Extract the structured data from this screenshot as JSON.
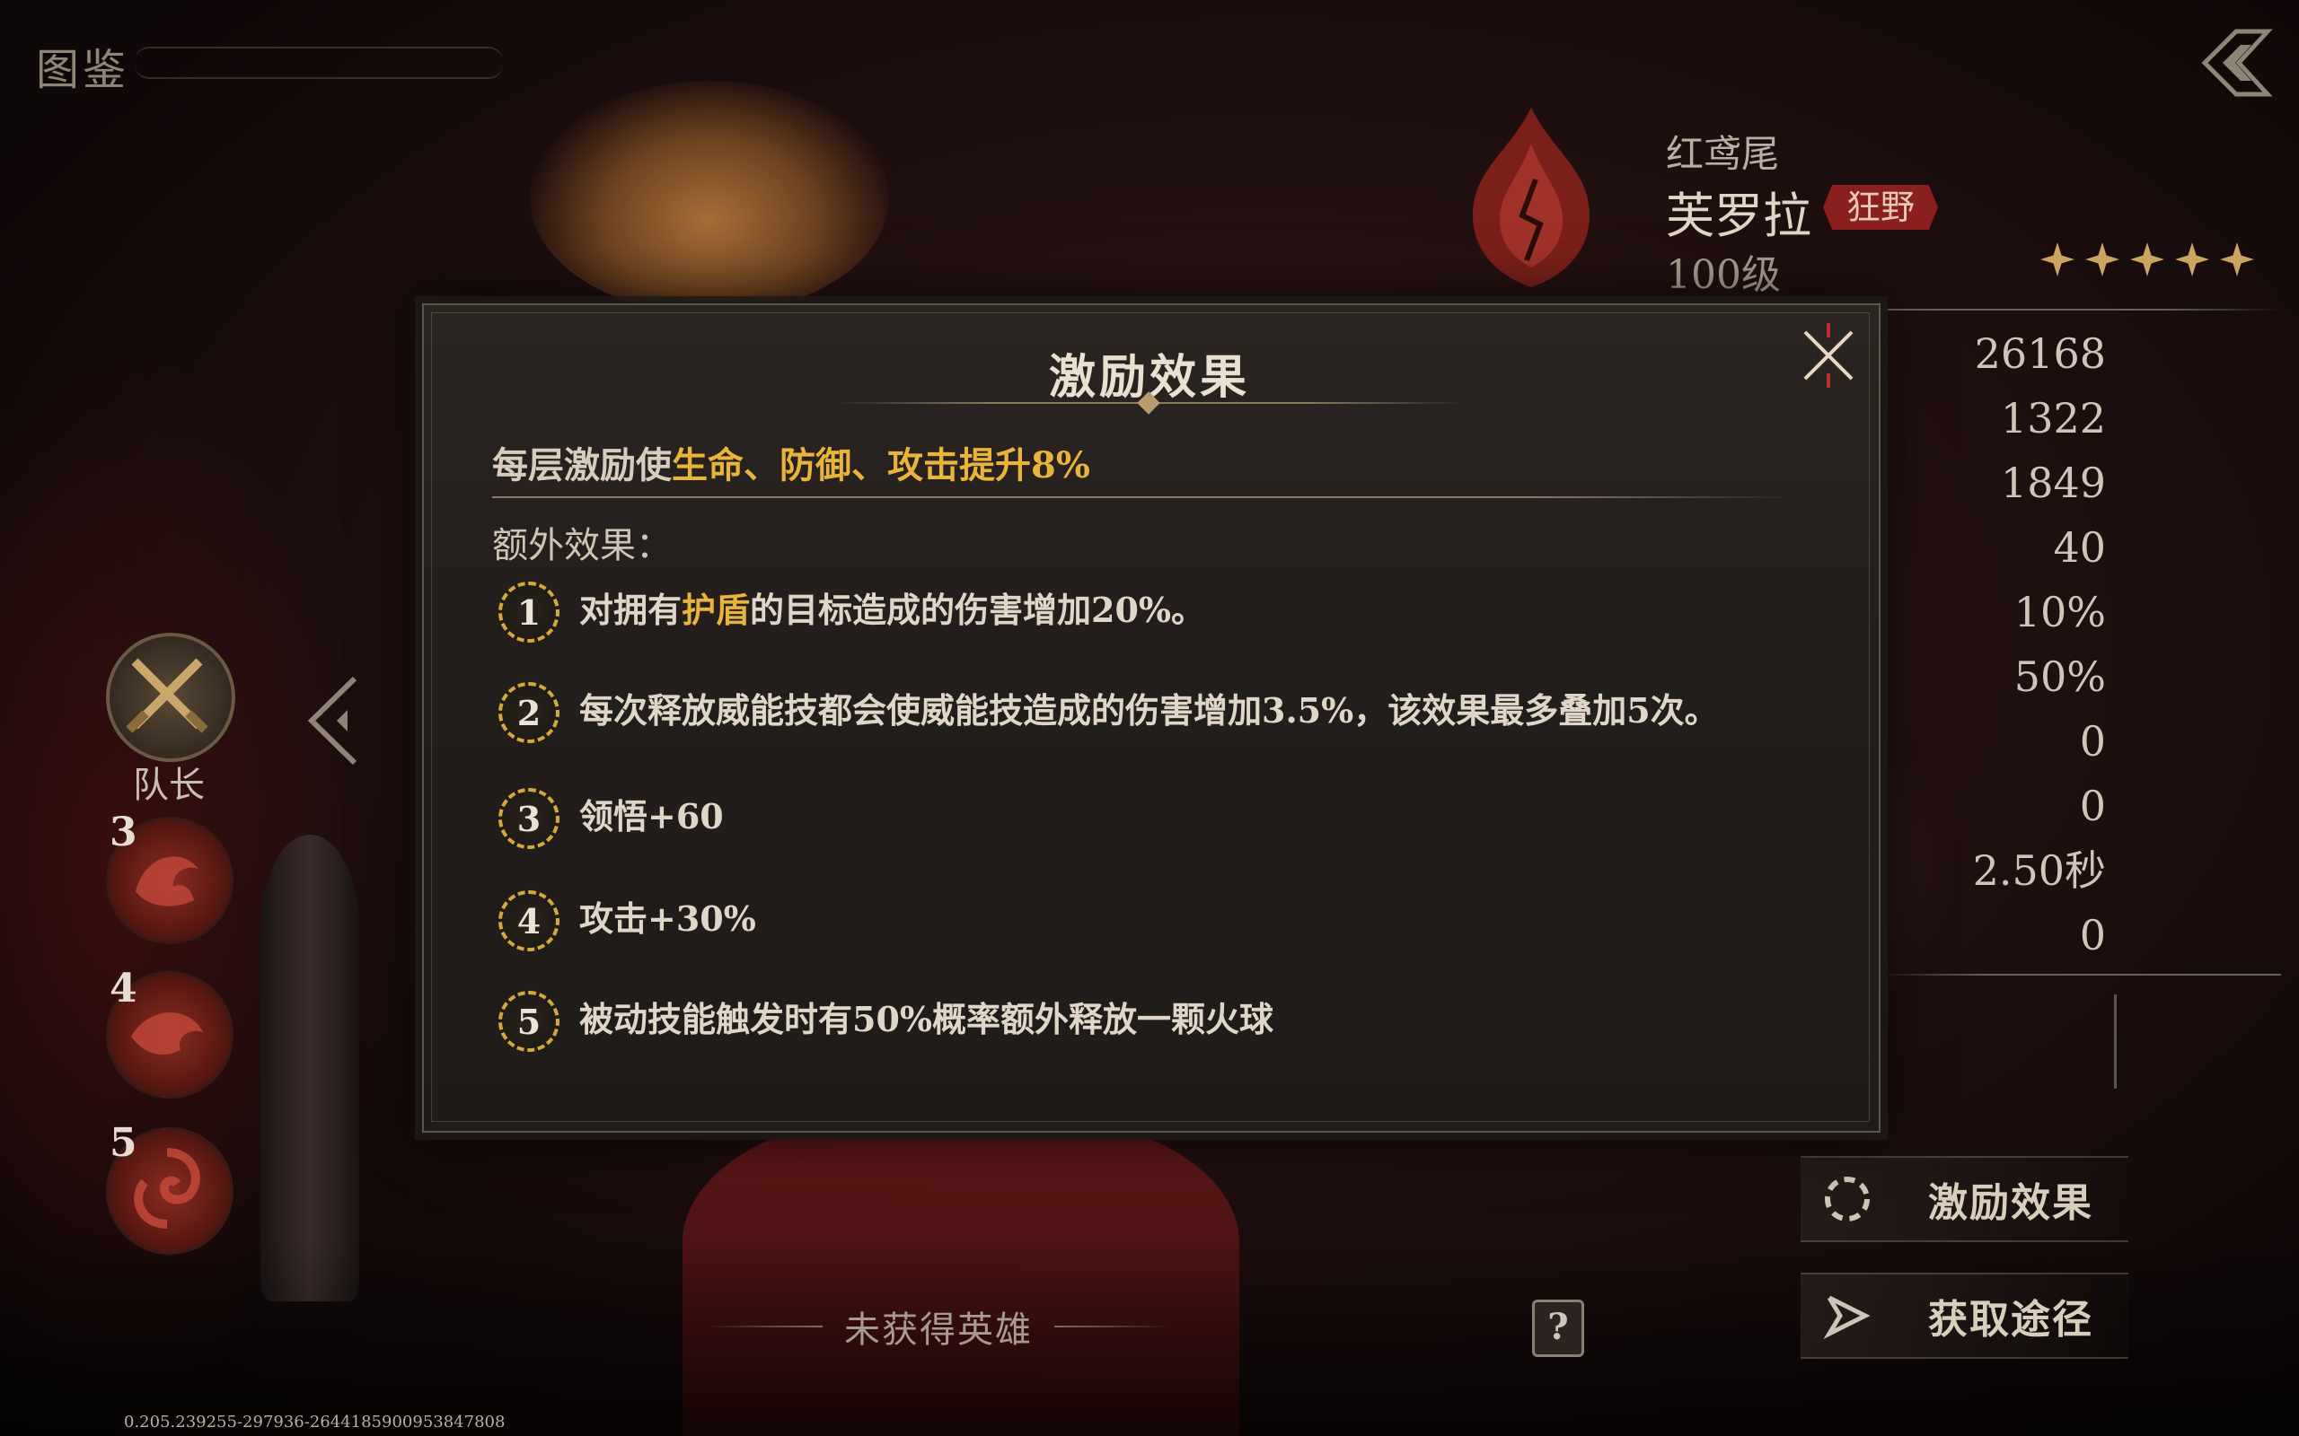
{
  "header": {
    "title": "图鉴"
  },
  "hero": {
    "subtitle": "红鸢尾",
    "name": "芙罗拉",
    "tag": "狂野",
    "level": "100级",
    "star_count": 5
  },
  "stats": [
    "26168",
    "1322",
    "1849",
    "40",
    "10%",
    "50%",
    "0",
    "0",
    "2.50秒",
    "0"
  ],
  "team": {
    "captain_label": "队长",
    "slots": [
      "3",
      "4",
      "5"
    ]
  },
  "actions": {
    "inspire_label": "激励效果",
    "obtain_label": "获取途径"
  },
  "bottom": {
    "unowned_label": "未获得英雄",
    "help_label": "?",
    "version": "0.205.239255-297936-2644185900953847808"
  },
  "modal": {
    "title": "激励效果",
    "head_prefix": "每层激励使",
    "head_highlight": "生命、防御、攻击提升8%",
    "extra_label": "额外效果：",
    "effects": [
      {
        "num": "1",
        "pre": "对拥有",
        "hl": "护盾",
        "post": "的目标造成的伤害增加20%。"
      },
      {
        "num": "2",
        "text": "每次释放威能技都会使威能技造成的伤害增加3.5%，该效果最多叠加5次。"
      },
      {
        "num": "3",
        "text": "领悟+60"
      },
      {
        "num": "4",
        "text": "攻击+30%"
      },
      {
        "num": "5",
        "text": "被动技能触发时有50%概率额外释放一颗火球"
      }
    ]
  },
  "colors": {
    "highlight": "#e8b53a",
    "tag_bg": "#8b1e1e",
    "ring": "#d5a83a"
  }
}
